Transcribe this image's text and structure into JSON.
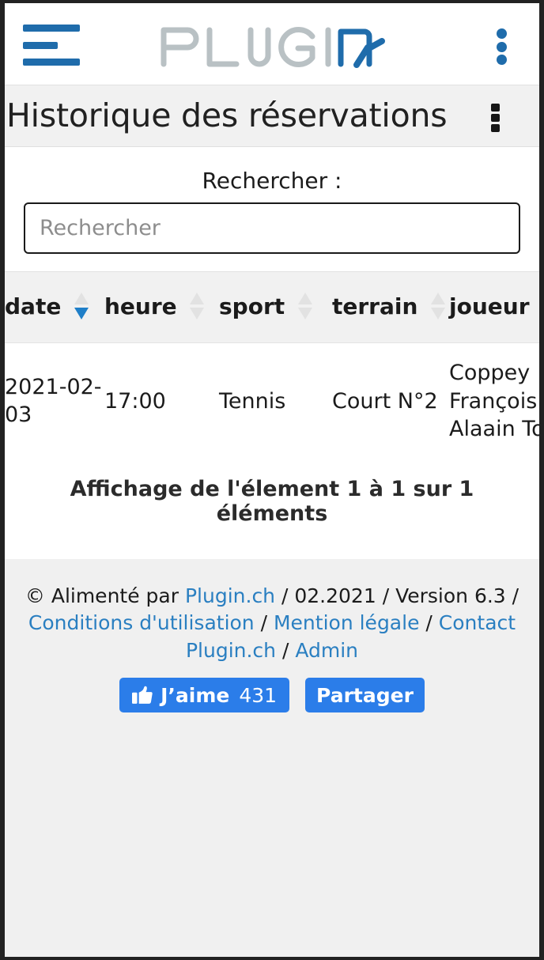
{
  "app": {
    "logo_text_gray": "PLUGI",
    "logo_text_blue": "N",
    "brand_blue": "#1f6cab",
    "brand_gray": "#b9c1c4"
  },
  "topbar": {
    "menu_icon": "hamburger-icon",
    "overflow_icon": "more-vertical-icon"
  },
  "page": {
    "title": "Historique des réservations",
    "overflow_icon": "more-vertical-icon"
  },
  "search": {
    "label": "Rechercher :",
    "placeholder": "Rechercher",
    "value": ""
  },
  "table": {
    "columns": [
      {
        "key": "date",
        "label": "date",
        "sort": "desc"
      },
      {
        "key": "heure",
        "label": "heure",
        "sort": "none"
      },
      {
        "key": "sport",
        "label": "sport",
        "sort": "none"
      },
      {
        "key": "terrain",
        "label": "terrain",
        "sort": "none"
      },
      {
        "key": "joueur",
        "label": "joueur",
        "sort": "none"
      }
    ],
    "rows": [
      {
        "date": "2021-02-03",
        "heure": "17:00",
        "sport": "Tennis",
        "terrain": "Court N°2",
        "joueur": "Coppey François Alaain Tonray"
      }
    ],
    "info": "Affichage de l'élement 1 à 1 sur 1 éléments"
  },
  "footer": {
    "copyright_prefix": "© Alimenté par ",
    "link_plugin": "Plugin.ch",
    "sep1": " / ",
    "date": "02.2021",
    "sep2": " / ",
    "version": "Version 6.3",
    "sep3": " / ",
    "link_terms": "Conditions d'utilisation",
    "sep4": " / ",
    "link_legal": "Mention légale",
    "sep5": " / ",
    "link_contact": "Contact Plugin.ch",
    "sep6": " / ",
    "link_admin": "Admin",
    "like_label": "J’aime",
    "like_count": "431",
    "share_label": "Partager",
    "accent_link": "#2a7fc1",
    "facebook_blue": "#2b7de9"
  }
}
